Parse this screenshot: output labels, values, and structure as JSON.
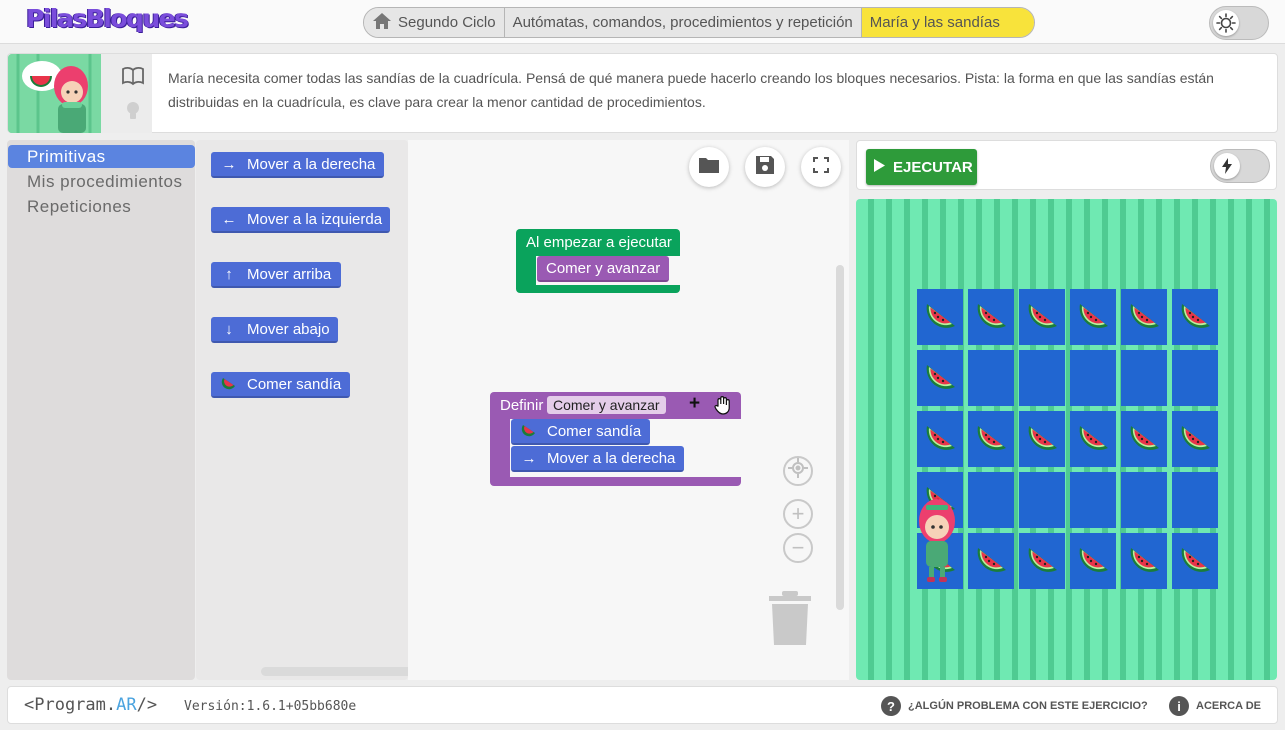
{
  "header": {
    "logo": "PilasBloques",
    "breadcrumb": [
      "Segundo Ciclo",
      "Autómatas, comandos, procedimientos y repetición",
      "María y las sandías"
    ]
  },
  "description": {
    "text": "María necesita comer todas las sandías de la cuadrícula. Pensá de qué manera puede hacerlo creando los bloques necesarios. Pista: la forma en que las sandías están distribuidas en la cuadrícula, es clave para crear la menor cantidad de procedimientos."
  },
  "toolbox": {
    "categories": [
      "Primitivas",
      "Mis procedimientos",
      "Repeticiones"
    ]
  },
  "flyout": {
    "blocks": [
      {
        "label": "Mover a la derecha",
        "icon": "arrow-right-icon",
        "glyph": "→"
      },
      {
        "label": "Mover a la izquierda",
        "icon": "arrow-left-icon",
        "glyph": "←"
      },
      {
        "label": "Mover arriba",
        "icon": "arrow-up-icon",
        "glyph": "↑"
      },
      {
        "label": "Mover abajo",
        "icon": "arrow-down-icon",
        "glyph": "↓"
      },
      {
        "label": "Comer sandía",
        "icon": "watermelon-icon",
        "glyph": ""
      }
    ]
  },
  "workspace": {
    "start_block": "Al empezar a ejecutar",
    "start_child": "Comer y avanzar",
    "define_keyword": "Definir",
    "procedure_name": "Comer y avanzar",
    "procedure_body": [
      "Comer sandía",
      "Mover a la derecha"
    ]
  },
  "run": {
    "run_label": "EJECUTAR"
  },
  "scene": {
    "grid": [
      [
        1,
        1,
        1,
        1,
        1,
        1
      ],
      [
        1,
        0,
        0,
        0,
        0,
        0
      ],
      [
        1,
        1,
        1,
        1,
        1,
        1
      ],
      [
        1,
        0,
        0,
        0,
        0,
        0
      ],
      [
        1,
        1,
        1,
        1,
        1,
        1
      ]
    ],
    "colors": {
      "cell": "#2166d1",
      "grass_light": "#6fe9b2",
      "grass_dark": "#4fcb92"
    }
  },
  "footer": {
    "programar_left": "<Program.",
    "programar_ar": "AR",
    "programar_right": "/>",
    "version": "Versión:1.6.1+05bb680e",
    "problem_link": "¿ALGÚN PROBLEMA CON ESTE EJERCICIO?",
    "about_link": "ACERCA DE"
  },
  "colors": {
    "accent_blue": "#5b84e0",
    "block_blue": "#4d6cd6",
    "block_purple": "#9a5ab3",
    "block_green": "#0aa35c",
    "run_green": "#2e9b3a",
    "breadcrumb_active": "#f8e33b"
  }
}
